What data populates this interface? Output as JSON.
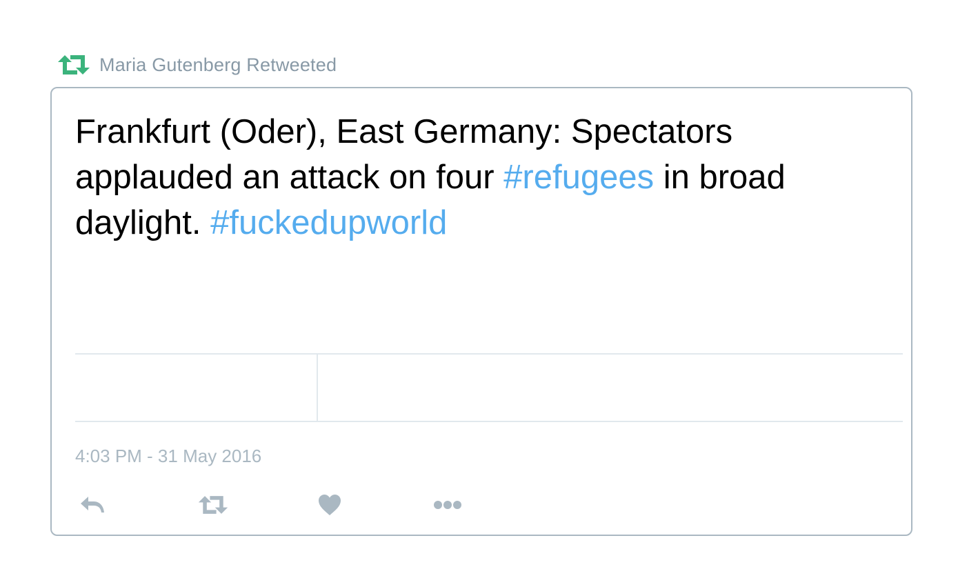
{
  "retweet_header": {
    "icon": "retweet-icon",
    "text": "Maria Gutenberg Retweeted",
    "color": "#3bb37c"
  },
  "tweet": {
    "text_parts": {
      "part1": "Frankfurt (Oder), East Germany: Spectators applauded an attack on four ",
      "hashtag1": "#refugees",
      "part2": " in broad daylight. ",
      "hashtag2": "#fuckedupworld"
    },
    "timestamp": "4:03 PM - 31 May 2016",
    "hashtag_color": "#55acee"
  },
  "actions": [
    {
      "icon": "reply-icon"
    },
    {
      "icon": "retweet-icon"
    },
    {
      "icon": "heart-icon"
    },
    {
      "icon": "more-icon"
    }
  ]
}
